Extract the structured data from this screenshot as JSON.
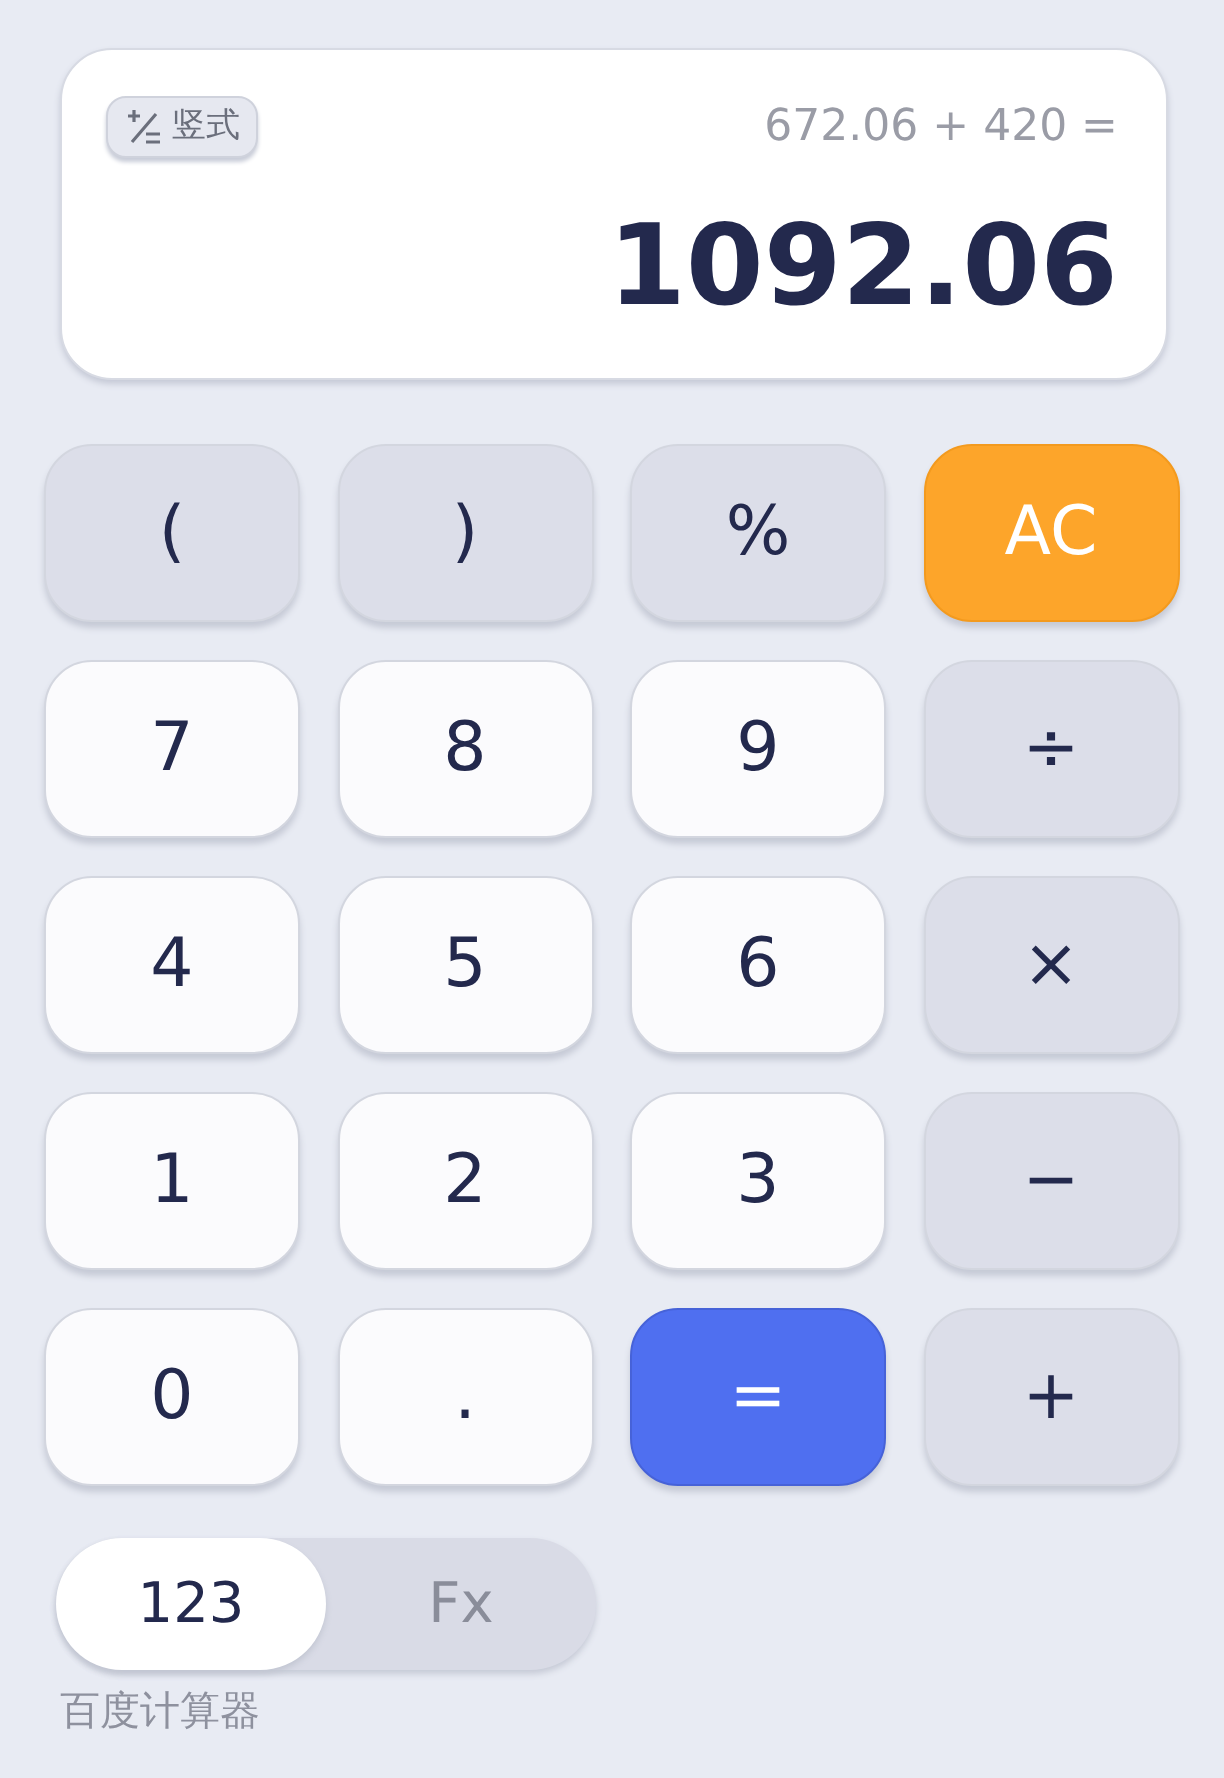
{
  "display": {
    "mode_button": {
      "label": "竖式"
    },
    "expression": "672.06 + 420 =",
    "result": "1092.06"
  },
  "keys": [
    {
      "label": "(",
      "kind": "op"
    },
    {
      "label": ")",
      "kind": "op"
    },
    {
      "label": "%",
      "kind": "op"
    },
    {
      "label": "AC",
      "kind": "clear"
    },
    {
      "label": "7",
      "kind": "digit"
    },
    {
      "label": "8",
      "kind": "digit"
    },
    {
      "label": "9",
      "kind": "digit"
    },
    {
      "label": "÷",
      "kind": "op"
    },
    {
      "label": "4",
      "kind": "digit"
    },
    {
      "label": "5",
      "kind": "digit"
    },
    {
      "label": "6",
      "kind": "digit"
    },
    {
      "label": "×",
      "kind": "op"
    },
    {
      "label": "1",
      "kind": "digit"
    },
    {
      "label": "2",
      "kind": "digit"
    },
    {
      "label": "3",
      "kind": "digit"
    },
    {
      "label": "−",
      "kind": "op"
    },
    {
      "label": "0",
      "kind": "digit"
    },
    {
      "label": ".",
      "kind": "digit"
    },
    {
      "label": "=",
      "kind": "equals"
    },
    {
      "label": "+",
      "kind": "op"
    }
  ],
  "mode_toggle": [
    {
      "label": "123",
      "selected": true
    },
    {
      "label": "Fx",
      "selected": false
    }
  ],
  "footer": "百度计算器"
}
